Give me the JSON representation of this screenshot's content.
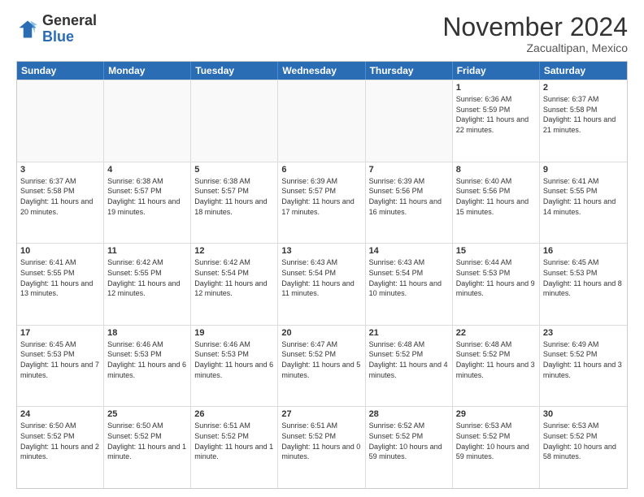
{
  "header": {
    "logo_general": "General",
    "logo_blue": "Blue",
    "month_title": "November 2024",
    "location": "Zacualtipan, Mexico"
  },
  "weekdays": [
    "Sunday",
    "Monday",
    "Tuesday",
    "Wednesday",
    "Thursday",
    "Friday",
    "Saturday"
  ],
  "rows": [
    [
      {
        "day": "",
        "info": ""
      },
      {
        "day": "",
        "info": ""
      },
      {
        "day": "",
        "info": ""
      },
      {
        "day": "",
        "info": ""
      },
      {
        "day": "",
        "info": ""
      },
      {
        "day": "1",
        "info": "Sunrise: 6:36 AM\nSunset: 5:59 PM\nDaylight: 11 hours and 22 minutes."
      },
      {
        "day": "2",
        "info": "Sunrise: 6:37 AM\nSunset: 5:58 PM\nDaylight: 11 hours and 21 minutes."
      }
    ],
    [
      {
        "day": "3",
        "info": "Sunrise: 6:37 AM\nSunset: 5:58 PM\nDaylight: 11 hours and 20 minutes."
      },
      {
        "day": "4",
        "info": "Sunrise: 6:38 AM\nSunset: 5:57 PM\nDaylight: 11 hours and 19 minutes."
      },
      {
        "day": "5",
        "info": "Sunrise: 6:38 AM\nSunset: 5:57 PM\nDaylight: 11 hours and 18 minutes."
      },
      {
        "day": "6",
        "info": "Sunrise: 6:39 AM\nSunset: 5:57 PM\nDaylight: 11 hours and 17 minutes."
      },
      {
        "day": "7",
        "info": "Sunrise: 6:39 AM\nSunset: 5:56 PM\nDaylight: 11 hours and 16 minutes."
      },
      {
        "day": "8",
        "info": "Sunrise: 6:40 AM\nSunset: 5:56 PM\nDaylight: 11 hours and 15 minutes."
      },
      {
        "day": "9",
        "info": "Sunrise: 6:41 AM\nSunset: 5:55 PM\nDaylight: 11 hours and 14 minutes."
      }
    ],
    [
      {
        "day": "10",
        "info": "Sunrise: 6:41 AM\nSunset: 5:55 PM\nDaylight: 11 hours and 13 minutes."
      },
      {
        "day": "11",
        "info": "Sunrise: 6:42 AM\nSunset: 5:55 PM\nDaylight: 11 hours and 12 minutes."
      },
      {
        "day": "12",
        "info": "Sunrise: 6:42 AM\nSunset: 5:54 PM\nDaylight: 11 hours and 12 minutes."
      },
      {
        "day": "13",
        "info": "Sunrise: 6:43 AM\nSunset: 5:54 PM\nDaylight: 11 hours and 11 minutes."
      },
      {
        "day": "14",
        "info": "Sunrise: 6:43 AM\nSunset: 5:54 PM\nDaylight: 11 hours and 10 minutes."
      },
      {
        "day": "15",
        "info": "Sunrise: 6:44 AM\nSunset: 5:53 PM\nDaylight: 11 hours and 9 minutes."
      },
      {
        "day": "16",
        "info": "Sunrise: 6:45 AM\nSunset: 5:53 PM\nDaylight: 11 hours and 8 minutes."
      }
    ],
    [
      {
        "day": "17",
        "info": "Sunrise: 6:45 AM\nSunset: 5:53 PM\nDaylight: 11 hours and 7 minutes."
      },
      {
        "day": "18",
        "info": "Sunrise: 6:46 AM\nSunset: 5:53 PM\nDaylight: 11 hours and 6 minutes."
      },
      {
        "day": "19",
        "info": "Sunrise: 6:46 AM\nSunset: 5:53 PM\nDaylight: 11 hours and 6 minutes."
      },
      {
        "day": "20",
        "info": "Sunrise: 6:47 AM\nSunset: 5:52 PM\nDaylight: 11 hours and 5 minutes."
      },
      {
        "day": "21",
        "info": "Sunrise: 6:48 AM\nSunset: 5:52 PM\nDaylight: 11 hours and 4 minutes."
      },
      {
        "day": "22",
        "info": "Sunrise: 6:48 AM\nSunset: 5:52 PM\nDaylight: 11 hours and 3 minutes."
      },
      {
        "day": "23",
        "info": "Sunrise: 6:49 AM\nSunset: 5:52 PM\nDaylight: 11 hours and 3 minutes."
      }
    ],
    [
      {
        "day": "24",
        "info": "Sunrise: 6:50 AM\nSunset: 5:52 PM\nDaylight: 11 hours and 2 minutes."
      },
      {
        "day": "25",
        "info": "Sunrise: 6:50 AM\nSunset: 5:52 PM\nDaylight: 11 hours and 1 minute."
      },
      {
        "day": "26",
        "info": "Sunrise: 6:51 AM\nSunset: 5:52 PM\nDaylight: 11 hours and 1 minute."
      },
      {
        "day": "27",
        "info": "Sunrise: 6:51 AM\nSunset: 5:52 PM\nDaylight: 11 hours and 0 minutes."
      },
      {
        "day": "28",
        "info": "Sunrise: 6:52 AM\nSunset: 5:52 PM\nDaylight: 10 hours and 59 minutes."
      },
      {
        "day": "29",
        "info": "Sunrise: 6:53 AM\nSunset: 5:52 PM\nDaylight: 10 hours and 59 minutes."
      },
      {
        "day": "30",
        "info": "Sunrise: 6:53 AM\nSunset: 5:52 PM\nDaylight: 10 hours and 58 minutes."
      }
    ]
  ]
}
